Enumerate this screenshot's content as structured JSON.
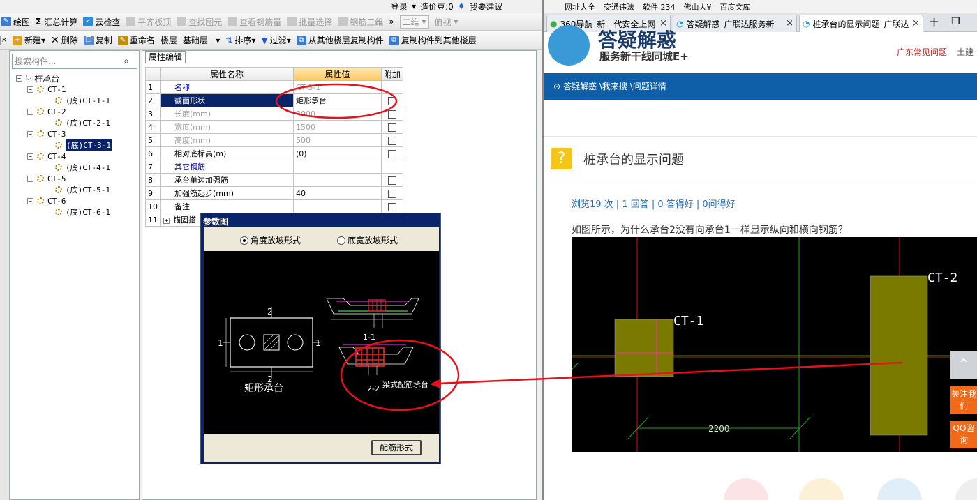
{
  "topbar": {
    "login": "登录",
    "cost": "造价豆:0",
    "suggest": "我要建议"
  },
  "bookmarks": [
    "网址大全",
    "交通违法",
    "软件 234",
    "佛山大¥",
    "百度文库"
  ],
  "toolbar1": {
    "draw": "绘图",
    "sum": "汇总计算",
    "cloud": "云检查",
    "items_disabled": [
      "平齐板顶",
      "查找图元",
      "查看钢筋量",
      "批量选择",
      "钢筋三维"
    ],
    "view2d": "二维",
    "view_top": "俯视"
  },
  "toolbar2": {
    "new": "新建",
    "delete": "删除",
    "copy": "复制",
    "rename": "重命名",
    "floor_label": "楼层",
    "floor_value": "基础层",
    "sort": "排序",
    "filter": "过滤",
    "copy_from": "从其他楼层复制构件",
    "copy_to": "复制构件到其他楼层"
  },
  "search": {
    "placeholder": "搜索构件..."
  },
  "tree": {
    "root": "桩承台",
    "items": [
      {
        "name": "CT-1",
        "child": "(底)CT-1-1"
      },
      {
        "name": "CT-2",
        "child": "(底)CT-2-1"
      },
      {
        "name": "CT-3",
        "child": "(底)CT-3-1"
      },
      {
        "name": "CT-4",
        "child": "(底)CT-4-1"
      },
      {
        "name": "CT-5",
        "child": "(底)CT-5-1"
      },
      {
        "name": "CT-6",
        "child": "(底)CT-6-1"
      }
    ]
  },
  "props": {
    "tab": "属性编辑",
    "headers": [
      "属性名称",
      "属性值",
      "附加"
    ],
    "rows": [
      {
        "no": "1",
        "name": "名称",
        "value": "CT-3-1"
      },
      {
        "no": "2",
        "name": "截面形状",
        "value": "矩形承台"
      },
      {
        "no": "3",
        "name": "长度(mm)",
        "value": "3000"
      },
      {
        "no": "4",
        "name": "宽度(mm)",
        "value": "1500"
      },
      {
        "no": "5",
        "name": "高度(mm)",
        "value": "500"
      },
      {
        "no": "6",
        "name": "相对底标高(m)",
        "value": "(0)"
      },
      {
        "no": "7",
        "name": "其它钢筋",
        "value": ""
      },
      {
        "no": "8",
        "name": "承台单边加强筋",
        "value": ""
      },
      {
        "no": "9",
        "name": "加强筋起步(mm)",
        "value": "40"
      },
      {
        "no": "10",
        "name": "备注",
        "value": ""
      },
      {
        "no": "11",
        "name": "锚固搭",
        "value": ""
      }
    ]
  },
  "dialog": {
    "title": "参数图",
    "radio1": "角度放坡形式",
    "radio2": "底宽放坡形式",
    "shape_label": "矩形承台",
    "dim_top": "2",
    "dim_left": "1",
    "dim_right": "1",
    "dim_bottom": "2",
    "sec1": "1-1",
    "sec2": "2-2",
    "beam_label": "梁式配筋承台",
    "button": "配筋形式"
  },
  "browser": {
    "tabs": [
      "360导航_新一代安全上网",
      "答疑解惑_广联达服务新",
      "桩承台的显示问题_广联达"
    ],
    "logo_title": "答疑解惑",
    "logo_sub": "服务新干线同城E+",
    "links": [
      "广东常见问题",
      "土建"
    ],
    "breadcrumb": "答疑解惑 \\我来搜 \\问题详情",
    "question_title": "桩承台的显示问题",
    "stats": "浏览19 次 | 1 回答 | 0 答得好 | 0问得好",
    "question_text": "如图所示，为什么承台2没有向承台1一样显示纵向和横向钢筋？",
    "cad_labels": {
      "ct1": "CT-1",
      "ct2": "CT-2",
      "dim": "2200"
    },
    "side": {
      "follow": "关注我们",
      "qq": "QQ咨询"
    }
  },
  "colors": {
    "annotation": "#e8101a",
    "selected": "#0a246a",
    "header_highlight": "#fbc663",
    "nav_blue": "#0f5ea8",
    "side_orange": "#f06a1a",
    "cad_fill": "#7a7a00"
  }
}
